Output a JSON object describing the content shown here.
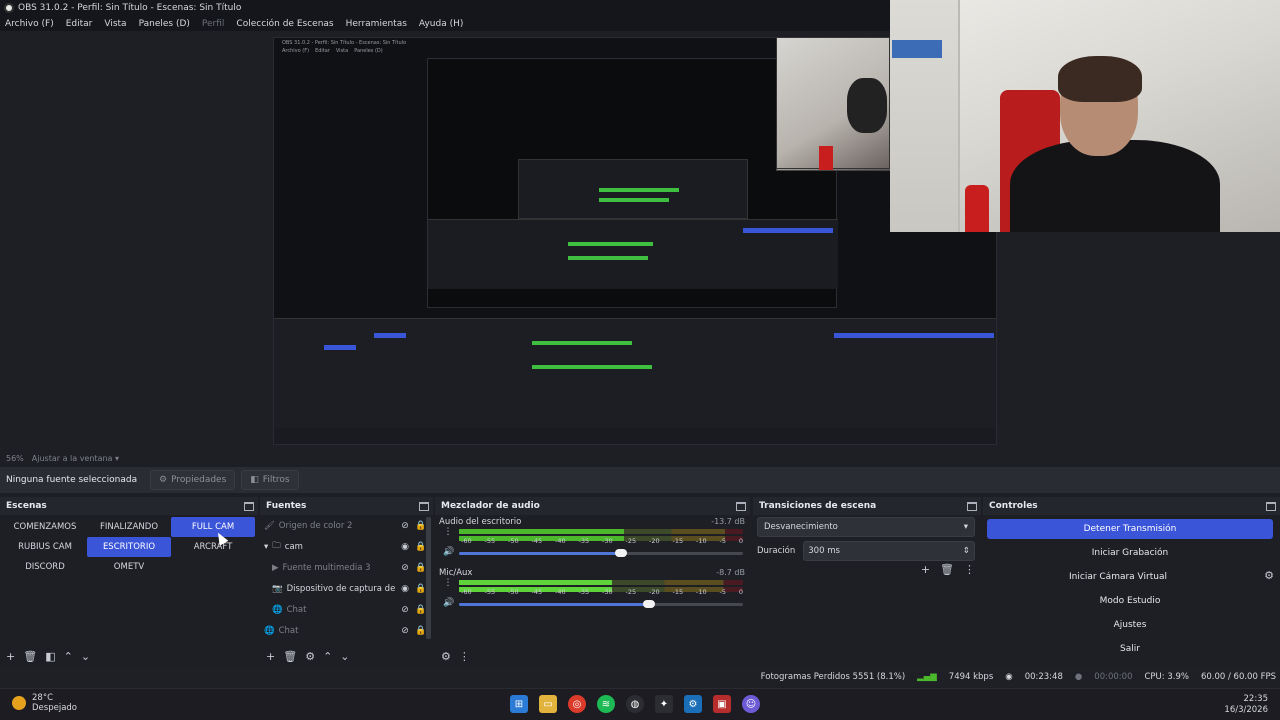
{
  "window": {
    "title": "OBS 31.0.2 - Perfil: Sin Título - Escenas: Sin Título"
  },
  "menu": [
    {
      "label": "Archivo (F)",
      "disabled": false
    },
    {
      "label": "Editar",
      "disabled": false
    },
    {
      "label": "Vista",
      "disabled": false
    },
    {
      "label": "Paneles (D)",
      "disabled": false
    },
    {
      "label": "Perfil",
      "disabled": true
    },
    {
      "label": "Colección de Escenas",
      "disabled": false
    },
    {
      "label": "Herramientas",
      "disabled": false
    },
    {
      "label": "Ayuda (H)",
      "disabled": false
    }
  ],
  "preview": {
    "zoom": "56%",
    "fit_label": "Ajustar a la ventana"
  },
  "propbar": {
    "no_source": "Ninguna fuente seleccionada",
    "properties": "Propiedades",
    "filters": "Filtros"
  },
  "scenes": {
    "title": "Escenas",
    "items": [
      "COMENZAMOS",
      "FINALIZANDO",
      "FULL CAM",
      "RUBIUS CAM",
      "ESCRITORIO",
      "ARCRAFT",
      "DISCORD",
      "OMETV"
    ],
    "active": [
      "FULL CAM",
      "ESCRITORIO"
    ]
  },
  "sources": {
    "title": "Fuentes",
    "items": [
      {
        "name": "Origen de color 2",
        "muted": true
      },
      {
        "name": "cam",
        "muted": false
      },
      {
        "name": "Fuente multimedia 3",
        "muted": true
      },
      {
        "name": "Dispositivo de captura de vídeo",
        "muted": false
      },
      {
        "name": "Chat",
        "muted": true
      },
      {
        "name": "Chat",
        "muted": true
      }
    ]
  },
  "mixer": {
    "title": "Mezclador de audio",
    "scale": [
      "-60",
      "-55",
      "-50",
      "-45",
      "-40",
      "-35",
      "-30",
      "-25",
      "-20",
      "-15",
      "-10",
      "-5",
      "0"
    ],
    "channels": [
      {
        "name": "Audio del escritorio",
        "db": "-13.7 dB",
        "level_pct": 58,
        "volume_pct": 57
      },
      {
        "name": "Mic/Aux",
        "db": "-8.7 dB",
        "level_pct": 54,
        "volume_pct": 67
      }
    ]
  },
  "transitions": {
    "title": "Transiciones de escena",
    "selected": "Desvanecimiento",
    "duration_label": "Duración",
    "duration_value": "300 ms"
  },
  "controls": {
    "title": "Controles",
    "stop_stream": "Detener Transmisión",
    "start_recording": "Iniciar Grabación",
    "start_virtual_cam": "Iniciar Cámara Virtual",
    "studio_mode": "Modo Estudio",
    "settings": "Ajustes",
    "exit": "Salir"
  },
  "status": {
    "dropped": "Fotogramas Perdidos 5551 (8.1%)",
    "bitrate": "7494 kbps",
    "stream_time": "00:23:48",
    "rec_time": "00:00:00",
    "cpu": "CPU: 3.9%",
    "fps": "60.00 / 60.00 FPS"
  },
  "taskbar": {
    "temp": "28°C",
    "weather": "Despejado",
    "time": "22:35",
    "date": "16/3/2026"
  },
  "colors": {
    "accent": "#3b55d9",
    "meter_green": "#4cb82b",
    "meter_yellow": "#d6a21b",
    "meter_red": "#7f1e2a"
  }
}
